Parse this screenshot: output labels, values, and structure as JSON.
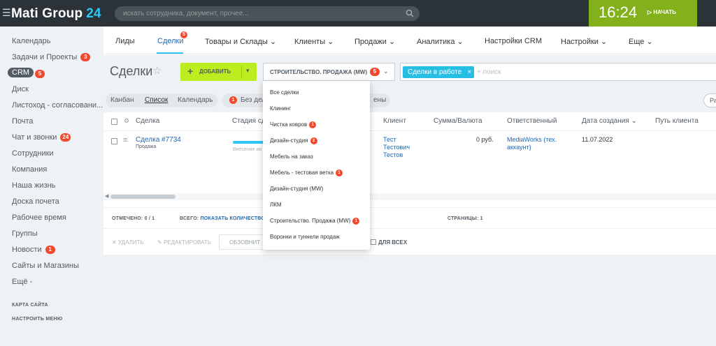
{
  "header": {
    "logo_text": "Mati Group",
    "logo_number": "24",
    "search_placeholder": "искать сотрудника, документ, прочее...",
    "time": "16:24",
    "start_label": "НАЧАТЬ"
  },
  "sidebar": {
    "items": [
      {
        "label": "Календарь"
      },
      {
        "label": "Задачи и Проекты",
        "badge": "3"
      },
      {
        "label": "CRM",
        "badge": "5",
        "active": true
      },
      {
        "label": "Диск"
      },
      {
        "label": "Листоход - согласовани..."
      },
      {
        "label": "Почта"
      },
      {
        "label": "Чат и звонки",
        "badge": "24"
      },
      {
        "label": "Сотрудники"
      },
      {
        "label": "Компания"
      },
      {
        "label": "Наша жизнь"
      },
      {
        "label": "Доска почета"
      },
      {
        "label": "Рабочее время"
      },
      {
        "label": "Группы"
      },
      {
        "label": "Новости",
        "badge": "1"
      },
      {
        "label": "Сайты и Магазины"
      },
      {
        "label": "Ещё -"
      }
    ],
    "sitemap": "КАРТА САЙТА",
    "configure_menu": "НАСТРОИТЬ МЕНЮ"
  },
  "nav": {
    "items": [
      "Лиды",
      "Сделки",
      "Товары и Склады",
      "Клиенты",
      "Продажи",
      "Аналитика",
      "Настройки CRM",
      "Настройки",
      "Еще"
    ],
    "deals_badge": "5"
  },
  "toolbar": {
    "title": "Сделки",
    "add_label": "ДОБАВИТЬ",
    "funnel_label": "СТРОИТЕЛЬСТВО. ПРОДАЖА (MW)",
    "funnel_badge": "5",
    "filter_tag": "Сделки в работе",
    "filter_placeholder": "+ поиск"
  },
  "views": {
    "tabs": [
      "Канбан",
      "Список",
      "Календарь"
    ],
    "counter_badge": "1",
    "counter_text": "Без дел",
    "counter_text_right": "ены",
    "right_pill": "Ра"
  },
  "grid": {
    "headers": [
      "Сделка",
      "Стадия сд",
      "Клиент",
      "Сумма/Валюта",
      "Ответственный",
      "Дата создания",
      "Путь клиента"
    ],
    "rows": [
      {
        "deal": "Сделка #7734",
        "deal_sub": "Продажа",
        "stage": "Внесение ав",
        "client_line1": "Тест",
        "client_line2": "Тестович",
        "client_line3": "Тестов",
        "amount": "0 руб.",
        "responsible_line1": "MediaWorks (тех.",
        "responsible_line2": "аккаунт)",
        "created": "11.07.2022"
      }
    ],
    "footer": {
      "selected_label": "ОТМЕЧЕНО: 0 / 1",
      "total_label": "ВСЕГО:",
      "total_link": "ПОКАЗАТЬ КОЛИЧЕСТВО",
      "pages": "СТРАНИЦЫ: 1"
    },
    "actions": {
      "delete": "УДАЛИТЬ",
      "edit": "РЕДАКТИРОВАТЬ",
      "refresh": "ОБЗОВНИТ",
      "for_all": "ДЛЯ ВСЕХ"
    }
  },
  "funnel_menu": {
    "items": [
      {
        "label": "Все сделки"
      },
      {
        "label": "Клининг"
      },
      {
        "label": "Чистка ковров",
        "badge": "1"
      },
      {
        "label": "Дизайн-студия",
        "badge": "2"
      },
      {
        "label": "Мебель на заказ"
      },
      {
        "label": "Мебель - тестовая ветка",
        "badge": "1"
      },
      {
        "label": "Дизайн-студия (MW)"
      },
      {
        "label": "ЛКМ"
      },
      {
        "label": "Строительство. Продажа (MW)",
        "badge": "1"
      },
      {
        "label": "Воронки и туннели продаж"
      }
    ]
  },
  "colors": {
    "header_bg": "#2b3338",
    "accent_blue": "#2fc6f6",
    "add_green": "#bbed21",
    "clock_green": "#83b11b",
    "badge_red": "#f2492e"
  }
}
